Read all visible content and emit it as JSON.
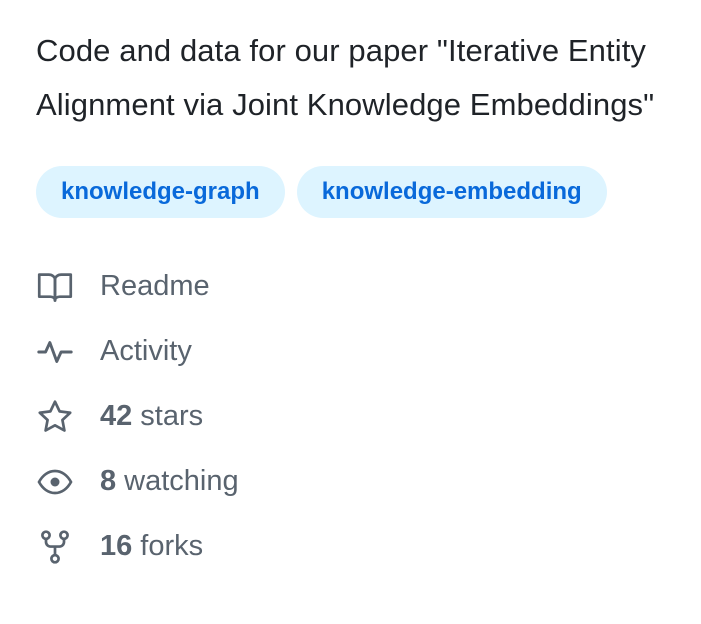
{
  "about": {
    "description": "Code and data for our paper \"Iterative Entity Alignment via Joint Knowledge Embeddings\"",
    "topics": [
      {
        "label": "knowledge-graph"
      },
      {
        "label": "knowledge-embedding"
      }
    ]
  },
  "meta": {
    "readme": {
      "label": "Readme",
      "icon": "book-icon"
    },
    "activity": {
      "label": "Activity",
      "icon": "pulse-icon"
    },
    "stars": {
      "count": "42",
      "label": "stars",
      "icon": "star-icon"
    },
    "watching": {
      "count": "8",
      "label": "watching",
      "icon": "eye-icon"
    },
    "forks": {
      "count": "16",
      "label": "forks",
      "icon": "repo-forked-icon"
    }
  },
  "colors": {
    "text": "#1f2328",
    "muted": "#59636e",
    "topic_bg": "#ddf4ff",
    "topic_fg": "#0969da"
  }
}
